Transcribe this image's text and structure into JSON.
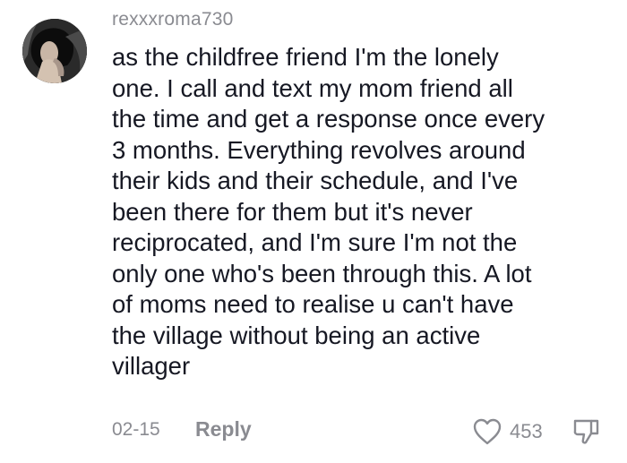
{
  "comment": {
    "username": "rexxxroma730",
    "body_lines": [
      "as the childfree friend I'm the lonely",
      "one. I call and text my mom friend all",
      "the time and get a response once every",
      "3 months. Everything revolves around",
      "their kids and their schedule, and I've",
      "been there for them but it's never",
      "reciprocated, and I'm sure I'm not the",
      "only one who's been through this. A lot",
      "of moms need to realise u can't have",
      "the village without being an active",
      "villager"
    ],
    "date": "02-15",
    "reply_label": "Reply",
    "like_count": "453",
    "icons": {
      "like": "heart-outline-icon",
      "dislike": "thumbs-down-icon"
    },
    "colors": {
      "text": "#161823",
      "muted": "#8a8b91"
    }
  }
}
